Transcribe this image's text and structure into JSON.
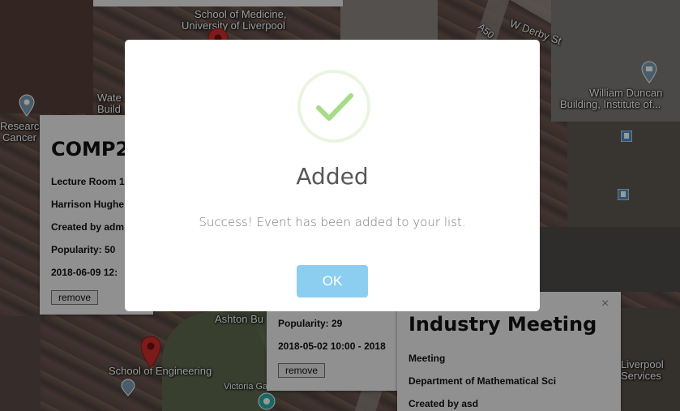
{
  "map": {
    "labels": {
      "school_of_medicine_line1": "School of Medicine,",
      "school_of_medicine_line2": "University of Liverpool",
      "w_derby_st": "W Derby St",
      "a50": "A50",
      "william_duncan_line1": "William Duncan",
      "william_duncan_line2": "Building, Institute of...",
      "waterhouse_line1": "Wate",
      "waterhouse_line2": "Build",
      "research_line1": "Research",
      "research_line2": "Cancer",
      "school_of_engineering": "School of Engineering",
      "ashton_building": "Ashton Bu",
      "victoria_gallery": "Victoria Galler",
      "liverpool_services_line1": "Liverpool",
      "liverpool_services_line2": "Services"
    }
  },
  "info_left": {
    "title": "COMP2",
    "room": "Lecture Room 1",
    "lecturer": "Harrison Hughe",
    "created_by": "Created by adm",
    "popularity": "Popularity: 50",
    "datetime": "2018-06-09 12:",
    "remove_label": "remove"
  },
  "info_middle": {
    "popularity": "Popularity: 29",
    "datetime": "2018-05-02 10:00 - 2018",
    "remove_label": "remove"
  },
  "info_right": {
    "title": "Industry Meeting",
    "type": "Meeting",
    "department": "Department of Mathematical Sci",
    "created_by": "Created by asd",
    "close_label": "×"
  },
  "modal": {
    "title": "Added",
    "text": "Success! Event has been added to your list.",
    "ok_label": "OK",
    "accent_color": "#8ccef0",
    "check_color": "#a5dc86"
  }
}
